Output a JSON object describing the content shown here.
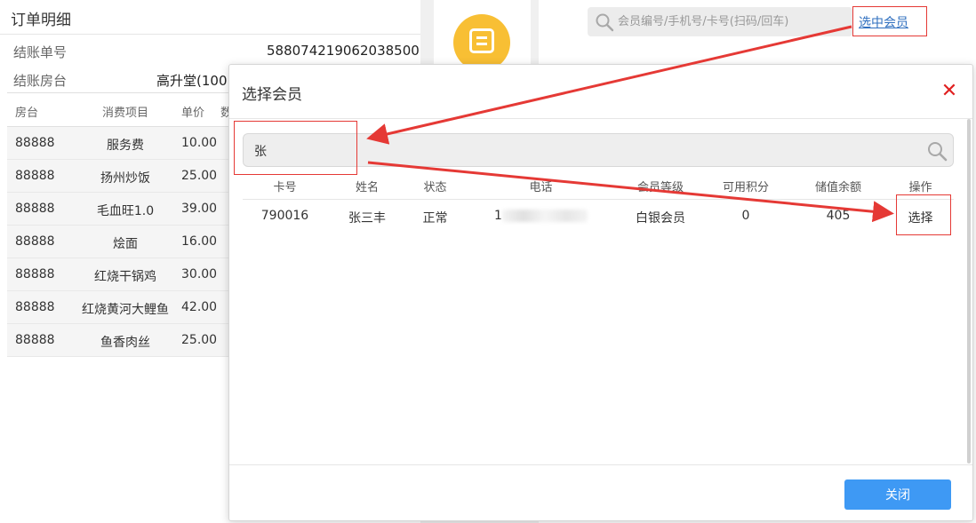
{
  "order": {
    "title": "订单明细",
    "bill_no_label": "结账单号",
    "bill_no": "588074219062038500",
    "room_label": "结账房台",
    "room_value": "高升堂(100",
    "columns": [
      "房台",
      "消费项目",
      "单价",
      "数"
    ],
    "items": [
      {
        "room": "88888",
        "item": "服务费",
        "price": "10.00"
      },
      {
        "room": "88888",
        "item": "扬州炒饭",
        "price": "25.00"
      },
      {
        "room": "88888",
        "item": "毛血旺1.0",
        "price": "39.00"
      },
      {
        "room": "88888",
        "item": "烩面",
        "price": "16.00"
      },
      {
        "room": "88888",
        "item": "红烧干锅鸡",
        "price": "30.00"
      },
      {
        "room": "88888",
        "item": "红烧黄河大鲤鱼",
        "price": "42.00"
      },
      {
        "room": "88888",
        "item": "鱼香肉丝",
        "price": "25.00"
      }
    ]
  },
  "member_panel": {
    "search_placeholder": "会员编号/手机号/卡号(扫码/回车)",
    "select_link": "选中会员"
  },
  "modal": {
    "title": "选择会员",
    "search_value": "张",
    "columns": {
      "card": "卡号",
      "name": "姓名",
      "status": "状态",
      "phone": "电话",
      "level": "会员等级",
      "points": "可用积分",
      "balance": "储值余额",
      "op": "操作"
    },
    "rows": [
      {
        "card": "790016",
        "name": "张三丰",
        "status": "正常",
        "phone_prefix": "1",
        "level": "白银会员",
        "points": "0",
        "balance": "405",
        "op": "选择"
      }
    ],
    "close_button": "关闭"
  },
  "colors": {
    "accent_blue": "#3e99f4",
    "link_blue": "#2f6fbf",
    "annotation_red": "#e53935",
    "icon_yellow": "#f8bf34"
  }
}
